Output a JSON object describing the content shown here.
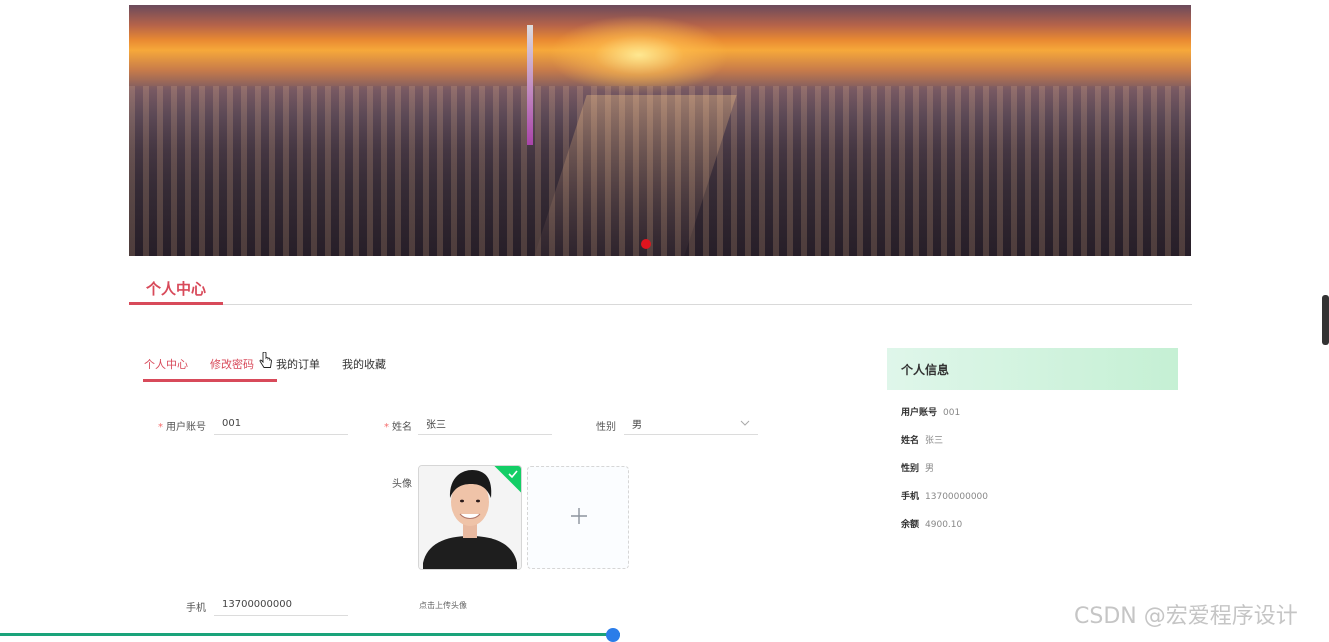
{
  "section": {
    "title": "个人中心"
  },
  "tabs": [
    {
      "label": "个人中心"
    },
    {
      "label": "修改密码"
    },
    {
      "label": "我的订单"
    },
    {
      "label": "我的收藏"
    }
  ],
  "form": {
    "account_label": "用户账号",
    "account_value": "001",
    "name_label": "姓名",
    "name_value": "张三",
    "gender_label": "性别",
    "gender_value": "男",
    "avatar_label": "头像",
    "phone_label": "手机",
    "phone_value": "13700000000",
    "upload_hint": "点击上传头像",
    "required_mark": "*"
  },
  "panel": {
    "title": "个人信息",
    "rows": [
      {
        "key": "用户账号",
        "value": "001"
      },
      {
        "key": "姓名",
        "value": "张三"
      },
      {
        "key": "性别",
        "value": "男"
      },
      {
        "key": "手机",
        "value": "13700000000"
      },
      {
        "key": "余额",
        "value": "4900.10"
      }
    ]
  },
  "watermark": "CSDN @宏爱程序设计",
  "colors": {
    "accent": "#d84a5a",
    "panel_bg": "#c5f0d4",
    "success": "#13ce66"
  }
}
